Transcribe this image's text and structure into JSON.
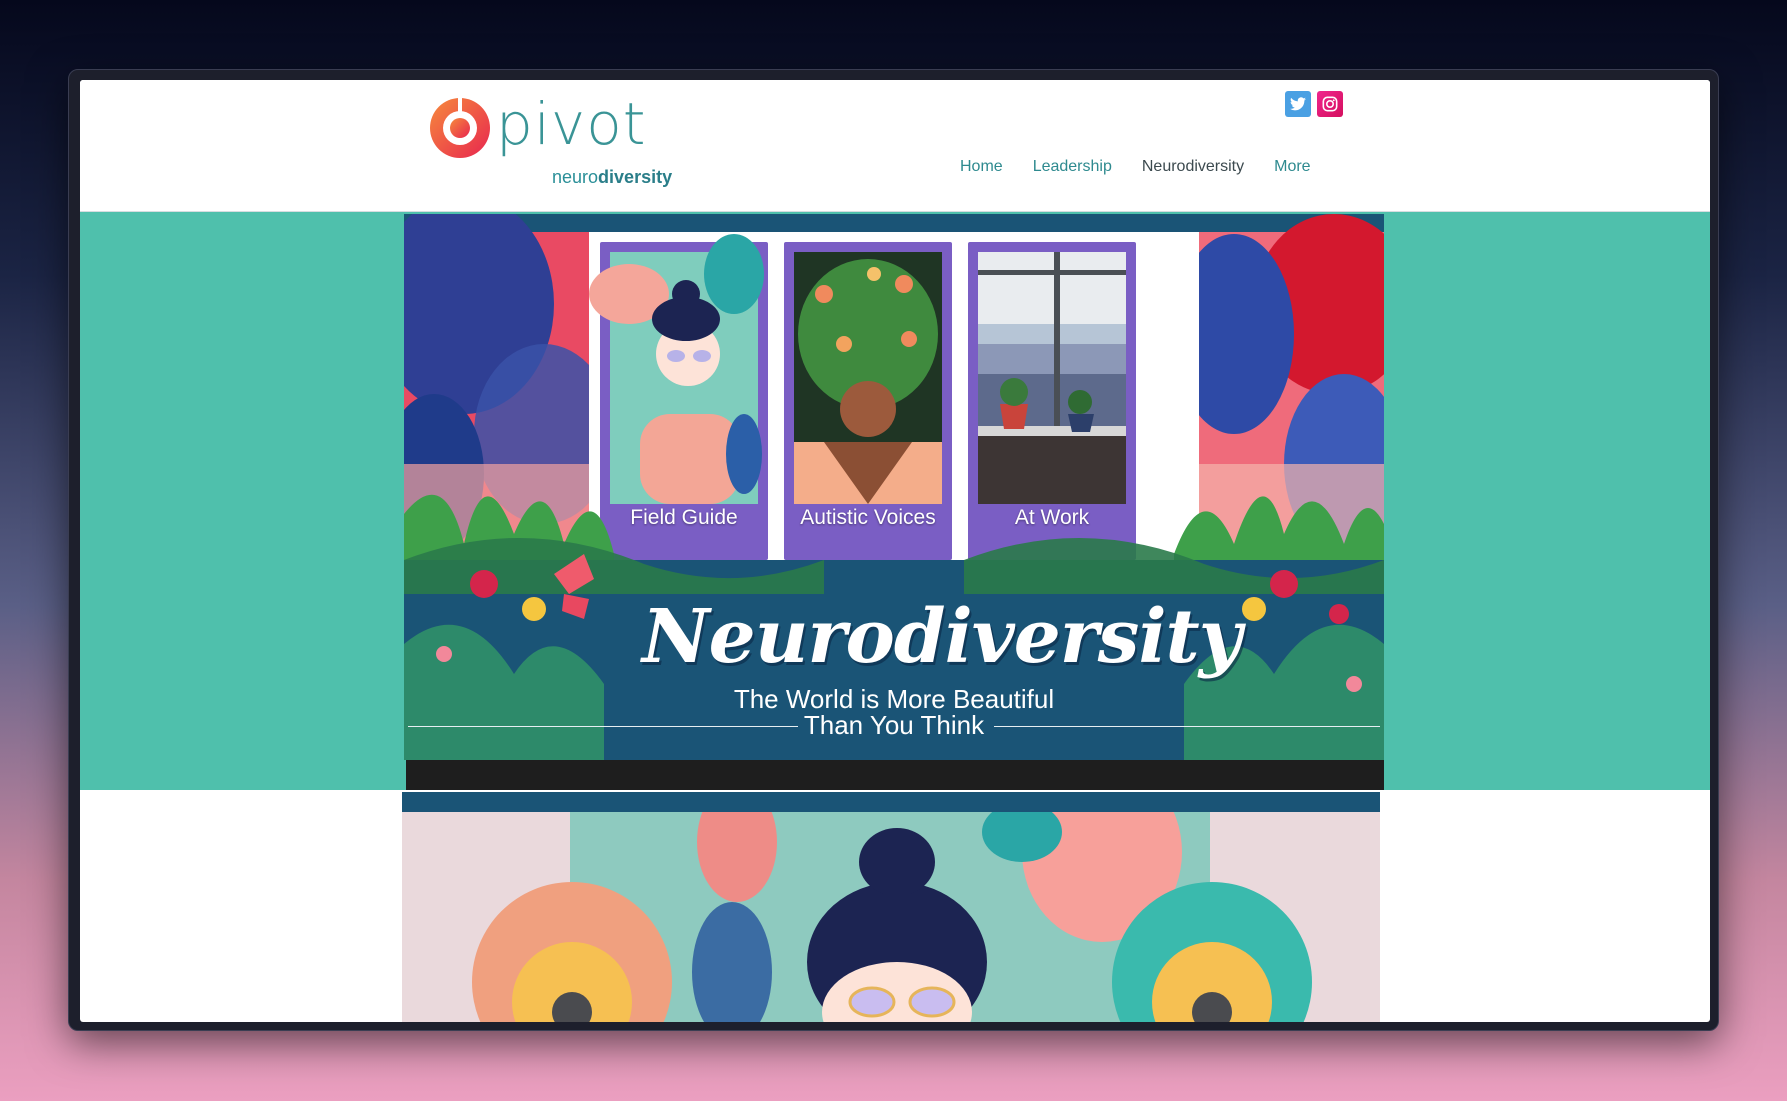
{
  "header": {
    "logo": {
      "word": "pivot",
      "sub_light": "neuro",
      "sub_bold": "diversity"
    },
    "social": [
      {
        "name": "twitter-icon",
        "color": "#4aa0e3"
      },
      {
        "name": "instagram-icon",
        "color": "#e01872"
      }
    ],
    "nav": [
      {
        "label": "Home",
        "active": false
      },
      {
        "label": "Leadership",
        "active": false
      },
      {
        "label": "Neurodiversity",
        "active": true
      },
      {
        "label": "More",
        "active": false
      }
    ]
  },
  "hero": {
    "cards": [
      {
        "label": "Field Guide"
      },
      {
        "label": "Autistic Voices"
      },
      {
        "label": "At Work"
      }
    ],
    "title": "Neurodiversity",
    "tagline_line1": "The World is More Beautiful",
    "tagline_line2": "Than You Think"
  },
  "colors": {
    "teal_band": "#4fc0ac",
    "nav_link": "#2e8a8f",
    "card_frame": "#7a5ec4",
    "banner_blue": "#1a5476"
  }
}
